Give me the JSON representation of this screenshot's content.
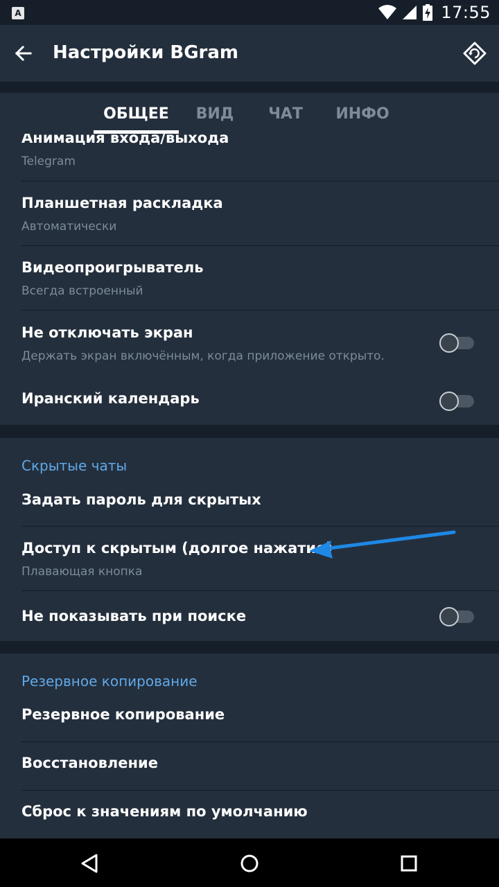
{
  "status": {
    "time": "17:55",
    "app_icon_letter": "A"
  },
  "appbar": {
    "title": "Настройки BGram",
    "back_icon": "arrow-back-icon",
    "reset_icon": "restore-icon"
  },
  "tabs": [
    {
      "label": "ОБЩЕЕ",
      "active": true
    },
    {
      "label": "ВИД",
      "active": false
    },
    {
      "label": "ЧАТ",
      "active": false
    },
    {
      "label": "ИНФО",
      "active": false
    }
  ],
  "general": [
    {
      "title": "Анимация входа/выхода",
      "subtitle": "Telegram"
    },
    {
      "title": "Планшетная раскладка",
      "subtitle": "Автоматически"
    },
    {
      "title": "Видеопроигрыватель",
      "subtitle": "Всегда встроенный"
    },
    {
      "title": "Не отключать экран",
      "subtitle": "Держать экран включённым, когда приложение открыто.",
      "toggle": false
    },
    {
      "title": "Иранский календарь",
      "toggle": false
    }
  ],
  "hidden_chats": {
    "header": "Скрытые чаты",
    "items": [
      {
        "title": "Задать пароль для скрытых"
      },
      {
        "title": "Доступ к скрытым (долгое нажатие)",
        "subtitle": "Плавающая кнопка"
      },
      {
        "title": "Не показывать при поиске",
        "toggle": false
      }
    ]
  },
  "backup": {
    "header": "Резервное копирование",
    "items": [
      {
        "title": "Резервное копирование"
      },
      {
        "title": "Восстановление"
      },
      {
        "title": "Сброс к значениям по умолчанию"
      }
    ]
  },
  "colors": {
    "accent": "#5fa9e8",
    "annotation_arrow": "#1e88e5",
    "surface": "#242f3d",
    "background": "#1d2733"
  },
  "navbar": {
    "icons": [
      "back-triangle-icon",
      "home-circle-icon",
      "recents-square-icon"
    ]
  }
}
